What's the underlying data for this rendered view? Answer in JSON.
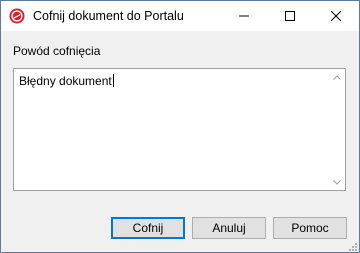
{
  "window": {
    "title": "Cofnij dokument do Portalu",
    "icon": "app-logo-icon"
  },
  "titlebar_controls": {
    "minimize_icon": "minimize-icon",
    "maximize_icon": "maximize-icon",
    "close_icon": "close-icon"
  },
  "form": {
    "reason_label": "Powód cofnięcia",
    "reason_value": "Błędny dokument"
  },
  "buttons": {
    "ok": "Cofnij",
    "cancel": "Anuluj",
    "help": "Pomoc"
  },
  "colors": {
    "default_button_border": "#0078d7",
    "app_icon_red": "#d21f2b"
  }
}
